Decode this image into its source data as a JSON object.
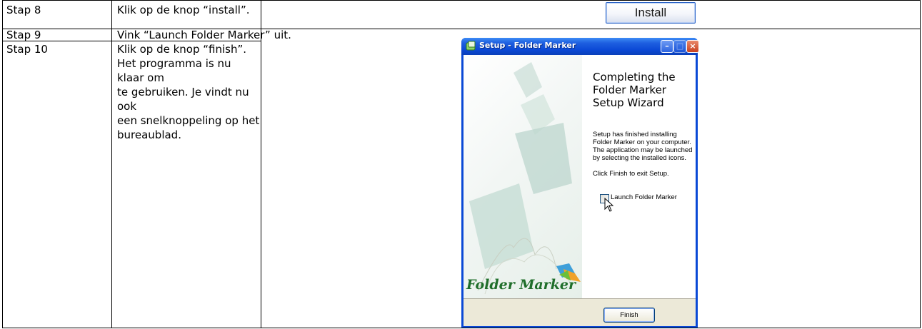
{
  "rows": [
    {
      "step": "Stap 8",
      "instruction": "Klik op de knop “install”."
    },
    {
      "step": "Stap 9",
      "instruction": "Vink “Launch Folder Marker” uit."
    },
    {
      "step": "Stap 10",
      "instruction_lines": [
        "Klik op de knop “finish”.",
        "Het programma is nu klaar om",
        "te gebruiken. Je vindt nu ook",
        "een snelknoppeling op het",
        "bureaublad."
      ]
    }
  ],
  "install_button": {
    "label": "Install"
  },
  "window": {
    "title": "Setup - Folder Marker",
    "heading": "Completing the Folder Marker Setup Wizard",
    "body": "Setup has finished installing Folder Marker on your computer. The application may be launched by selecting the installed icons.",
    "exit_text": "Click Finish to exit Setup.",
    "checkbox_label": "Launch Folder Marker",
    "checkbox_checked": false,
    "logo_text": "Folder Marker",
    "finish_label": "Finish"
  }
}
